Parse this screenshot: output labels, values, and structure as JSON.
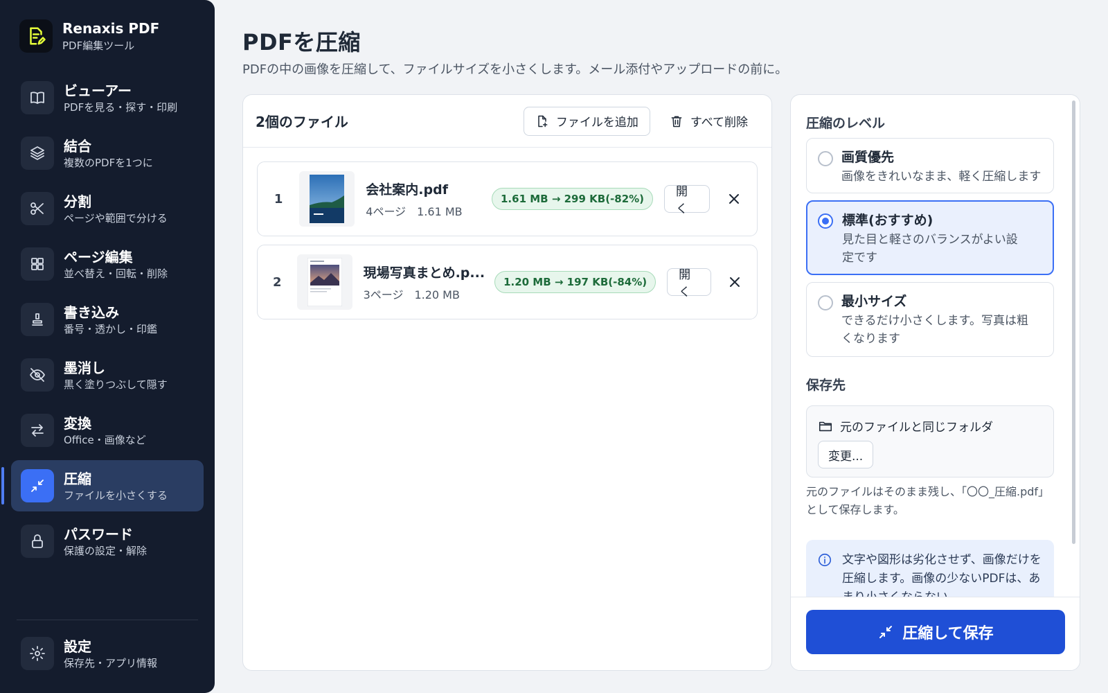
{
  "brand": {
    "name": "Renaxis PDF",
    "subtitle": "PDF編集ツール",
    "logo_icon": "document-edit-icon",
    "accent": "#e6ff3a"
  },
  "sidebar": {
    "items": [
      {
        "title": "ビューアー",
        "subtitle": "PDFを見る・探す・印刷",
        "icon": "book-icon",
        "active": false
      },
      {
        "title": "結合",
        "subtitle": "複数のPDFを1つに",
        "icon": "layers-icon",
        "active": false
      },
      {
        "title": "分割",
        "subtitle": "ページや範囲で分ける",
        "icon": "scissors-icon",
        "active": false
      },
      {
        "title": "ページ編集",
        "subtitle": "並べ替え・回転・削除",
        "icon": "grid-icon",
        "active": false
      },
      {
        "title": "書き込み",
        "subtitle": "番号・透かし・印鑑",
        "icon": "stamp-icon",
        "active": false
      },
      {
        "title": "墨消し",
        "subtitle": "黒く塗りつぶして隠す",
        "icon": "eye-off-icon",
        "active": false
      },
      {
        "title": "変換",
        "subtitle": "Office・画像など",
        "icon": "arrows-swap-icon",
        "active": false
      },
      {
        "title": "圧縮",
        "subtitle": "ファイルを小さくする",
        "icon": "compress-icon",
        "active": true
      },
      {
        "title": "パスワード",
        "subtitle": "保護の設定・解除",
        "icon": "lock-icon",
        "active": false
      }
    ],
    "settings": {
      "title": "設定",
      "subtitle": "保存先・アプリ情報",
      "icon": "gear-icon"
    }
  },
  "main": {
    "title": "PDFを圧縮",
    "description": "PDFの中の画像を圧縮して、ファイルサイズを小さくします。メール添付やアップロードの前に。"
  },
  "files": {
    "count_label": "2個のファイル",
    "add_label": "ファイルを追加",
    "clear_label": "すべて削除",
    "open_label": "開く",
    "items": [
      {
        "index": "1",
        "name": "会社案内.pdf",
        "meta": "4ページ　1.61 MB",
        "reduction": "1.61 MB → 299 KB(-82%)"
      },
      {
        "index": "2",
        "name": "現場写真まとめ.p...",
        "meta": "3ページ　1.20 MB",
        "reduction": "1.20 MB → 197 KB(-84%)"
      }
    ]
  },
  "settings_panel": {
    "level_label": "圧縮のレベル",
    "options": [
      {
        "title": "画質優先",
        "desc": "画像をきれいなまま、軽く圧縮します",
        "selected": false
      },
      {
        "title": "標準(おすすめ)",
        "desc": "見た目と軽さのバランスがよい設定です",
        "selected": true
      },
      {
        "title": "最小サイズ",
        "desc": "できるだけ小さくします。写真は粗くなります",
        "selected": false
      }
    ],
    "save_label": "保存先",
    "save_path": "元のファイルと同じフォルダ",
    "change_label": "変更...",
    "save_note": "元のファイルはそのまま残し、「〇〇_圧縮.pdf」として保存します。",
    "info_text": "文字や図形は劣化させず、画像だけを圧縮します。画像の少ないPDFは、あまり小さくならない",
    "primary_label": "圧縮して保存"
  },
  "colors": {
    "sidebar_bg": "#141c2d",
    "active_nav": "#2a3d62",
    "primary": "#1f4fd6",
    "success": "#1d6b3a"
  }
}
